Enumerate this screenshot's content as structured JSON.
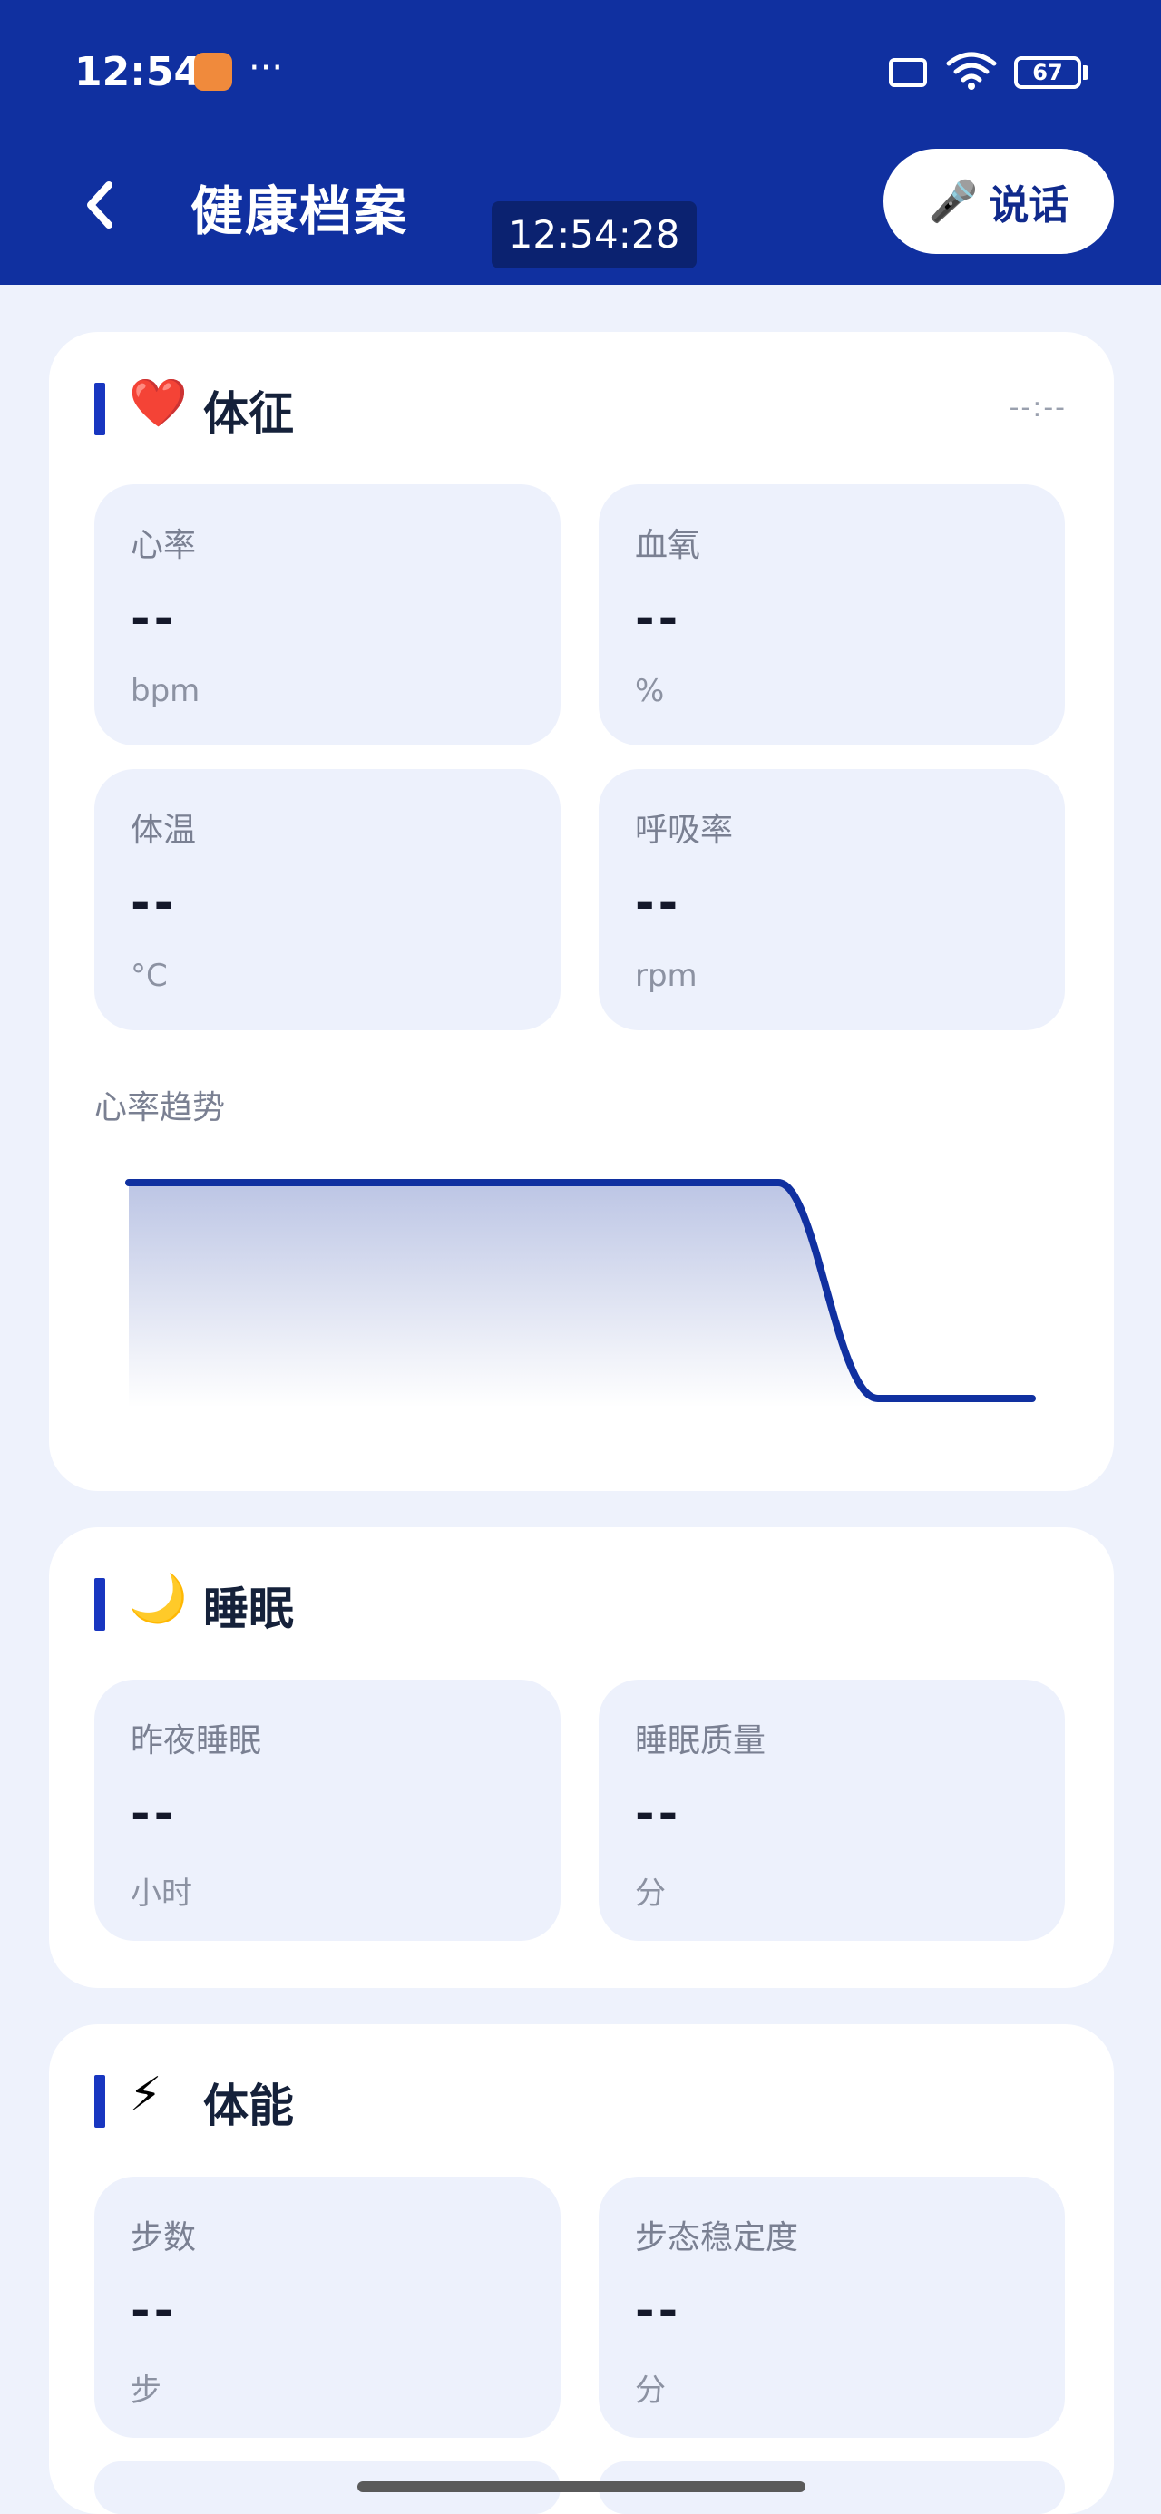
{
  "status_bar": {
    "time": "12:54",
    "dots": "···",
    "battery": "67"
  },
  "header": {
    "title": "健康档案",
    "clock": "12:54:28",
    "speak_label": "说话"
  },
  "vitals": {
    "icon": "❤️",
    "title": "体征",
    "time": "--:--",
    "tiles": [
      {
        "label": "心率",
        "value": "--",
        "unit": "bpm"
      },
      {
        "label": "血氧",
        "value": "--",
        "unit": "%"
      },
      {
        "label": "体温",
        "value": "--",
        "unit": "°C"
      },
      {
        "label": "呼吸率",
        "value": "--",
        "unit": "rpm"
      }
    ],
    "trend_label": "心率趋势"
  },
  "sleep": {
    "icon": "🌙",
    "title": "睡眠",
    "tiles": [
      {
        "label": "昨夜睡眠",
        "value": "--",
        "unit": "小时"
      },
      {
        "label": "睡眠质量",
        "value": "--",
        "unit": "分"
      }
    ]
  },
  "fitness": {
    "icon": "⚡",
    "title": "体能",
    "tiles": [
      {
        "label": "步数",
        "value": "--",
        "unit": "步"
      },
      {
        "label": "步态稳定度",
        "value": "--",
        "unit": "分"
      }
    ]
  },
  "colors": {
    "primary": "#1030A0",
    "accent": "#1836C0",
    "tile_bg": "#EDF1FC",
    "page_bg": "#EEF2FC"
  },
  "icons": {
    "back": "chevron-left-icon",
    "mic": "microphone-icon",
    "wifi": "wifi-icon",
    "sim": "sim-icon",
    "battery": "battery-icon"
  }
}
